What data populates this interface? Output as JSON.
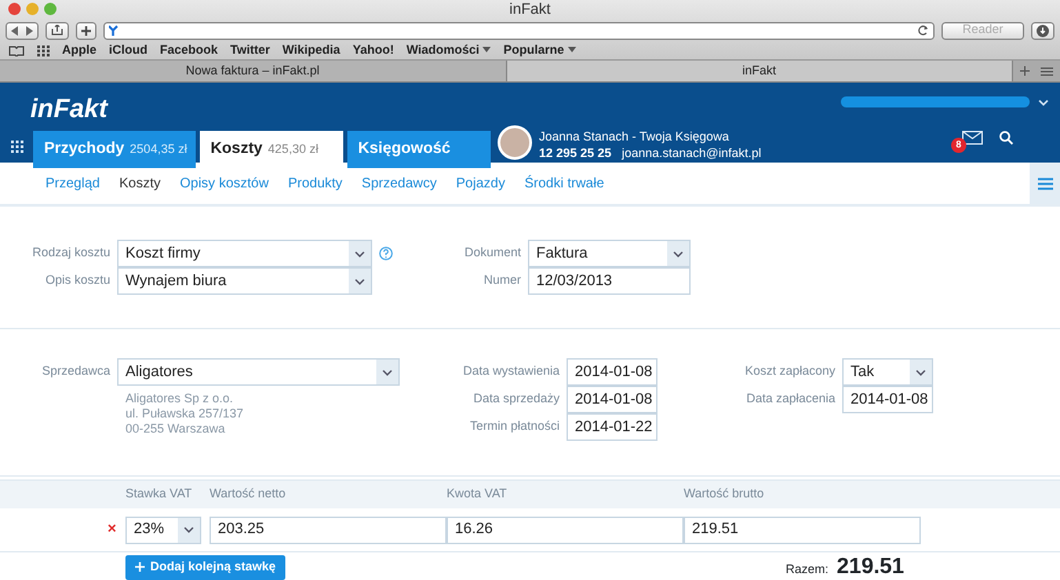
{
  "browser": {
    "title": "inFakt",
    "reader_button": "Reader",
    "bookmarks": [
      "Apple",
      "iCloud",
      "Facebook",
      "Twitter",
      "Wikipedia",
      "Yahoo!",
      {
        "label": "Wiadomości",
        "menu": true
      },
      {
        "label": "Popularne",
        "menu": true
      }
    ],
    "tabs": [
      {
        "label": "Nowa faktura – inFakt.pl",
        "selected": false
      },
      {
        "label": "inFakt",
        "selected": true
      }
    ]
  },
  "app": {
    "logo": "inFakt",
    "top_tabs": [
      {
        "label": "Przychody",
        "amount": "2504,35 zł",
        "selected": false
      },
      {
        "label": "Koszty",
        "amount": "425,30 zł",
        "selected": true
      },
      {
        "label": "Księgowość",
        "selected": false
      }
    ],
    "accountant": {
      "name": "Joanna Stanach - Twoja Księgowa",
      "phone": "12 295 25 25",
      "email": "joanna.stanach@infakt.pl"
    },
    "notification_count": "8",
    "subnav": [
      {
        "label": "Przegląd",
        "selected": false
      },
      {
        "label": "Koszty",
        "selected": true
      },
      {
        "label": "Opisy kosztów",
        "selected": false
      },
      {
        "label": "Produkty",
        "selected": false
      },
      {
        "label": "Sprzedawcy",
        "selected": false
      },
      {
        "label": "Pojazdy",
        "selected": false
      },
      {
        "label": "Środki trwałe",
        "selected": false
      }
    ]
  },
  "cost": {
    "left": [
      {
        "label": "Rodzaj kosztu",
        "value": "Koszt firmy",
        "help": true
      },
      {
        "label": "Opis kosztu",
        "value": "Wynajem biura",
        "help": false
      }
    ],
    "right": [
      {
        "label": "Dokument",
        "value": "Faktura",
        "kind": "select"
      },
      {
        "label": "Numer",
        "value": "12/03/2013",
        "kind": "text"
      }
    ]
  },
  "seller": {
    "label": "Sprzedawca",
    "value": "Aligatores",
    "address": [
      "Aligatores Sp z o.o.",
      "ul. Puławska 257/137",
      "00-255 Warszawa"
    ]
  },
  "dates": [
    {
      "label": "Data wystawienia",
      "value": "2014-01-08"
    },
    {
      "label": "Data sprzedaży",
      "value": "2014-01-08"
    },
    {
      "label": "Termin płatności",
      "value": "2014-01-22"
    }
  ],
  "payment": [
    {
      "label": "Koszt zapłacony",
      "value": "Tak",
      "kind": "select"
    },
    {
      "label": "Data zapłacenia",
      "value": "2014-01-08",
      "kind": "text"
    }
  ],
  "vat": {
    "columns": [
      "Stawka VAT",
      "Wartość netto",
      "Kwota VAT",
      "Wartość brutto"
    ],
    "rows": [
      {
        "rate": "23%",
        "net": "203.25",
        "vat": "16.26",
        "gross": "219.51",
        "remove": "×"
      }
    ],
    "add_button": "Dodaj kolejną stawkę",
    "total_label": "Razem:",
    "total": "219.51"
  }
}
